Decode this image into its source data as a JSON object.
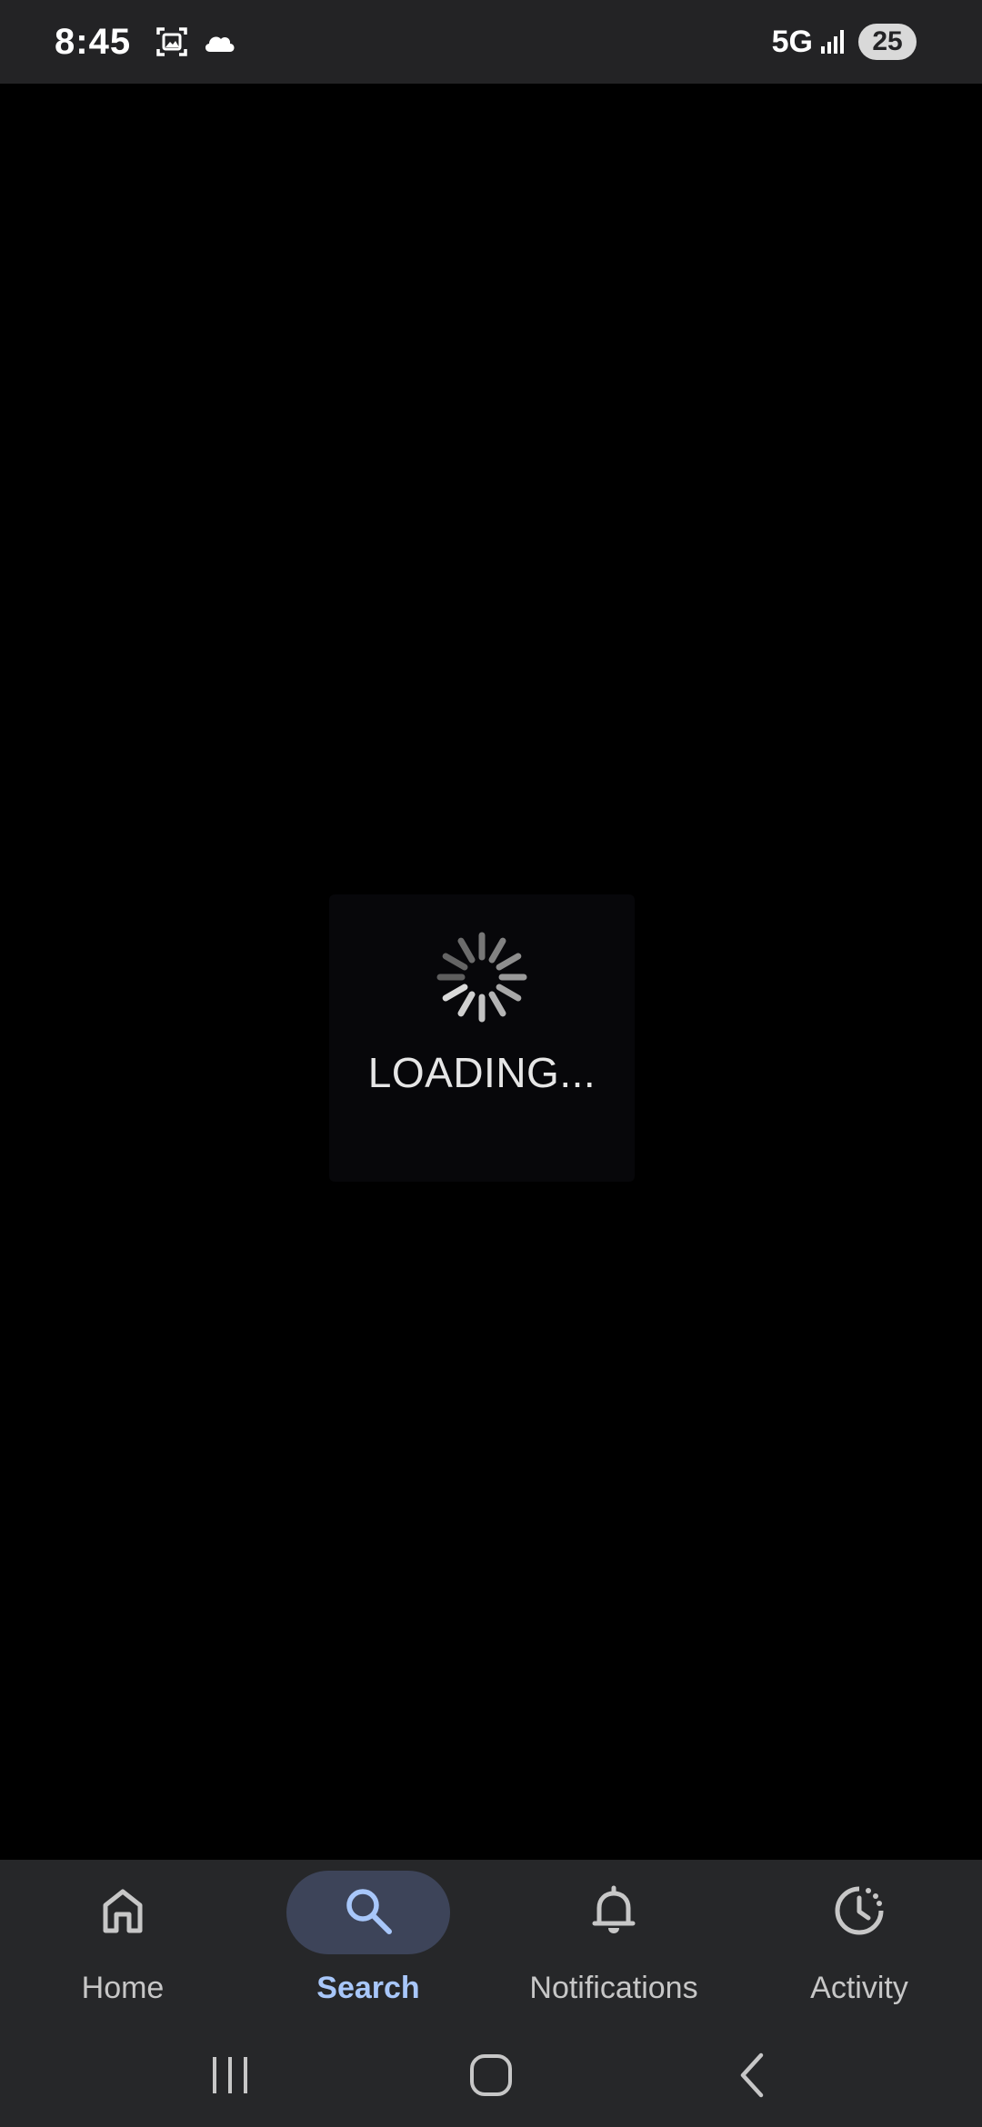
{
  "status_bar": {
    "time": "8:45",
    "icons": [
      "screenshot-icon",
      "cloud-icon"
    ],
    "network": "5G",
    "signal_icon": "signal-bars-icon",
    "battery": "25"
  },
  "loading": {
    "text": "LOADING...",
    "spinner_icon": "spinner-icon"
  },
  "bottom_nav": {
    "items": [
      {
        "label": "Home",
        "icon": "home-icon",
        "active": false
      },
      {
        "label": "Search",
        "icon": "search-icon",
        "active": true
      },
      {
        "label": "Notifications",
        "icon": "bell-icon",
        "active": false
      },
      {
        "label": "Activity",
        "icon": "activity-clock-icon",
        "active": false
      }
    ]
  },
  "system_nav": {
    "buttons": [
      "recents-icon",
      "home-button-icon",
      "back-icon"
    ]
  },
  "colors": {
    "background": "#000000",
    "bar_background": "#262729",
    "status_bar_background": "#232325",
    "active_pill": "#3d4459",
    "active_label": "#a8c7fa",
    "inactive_label": "#c7c7c7"
  }
}
